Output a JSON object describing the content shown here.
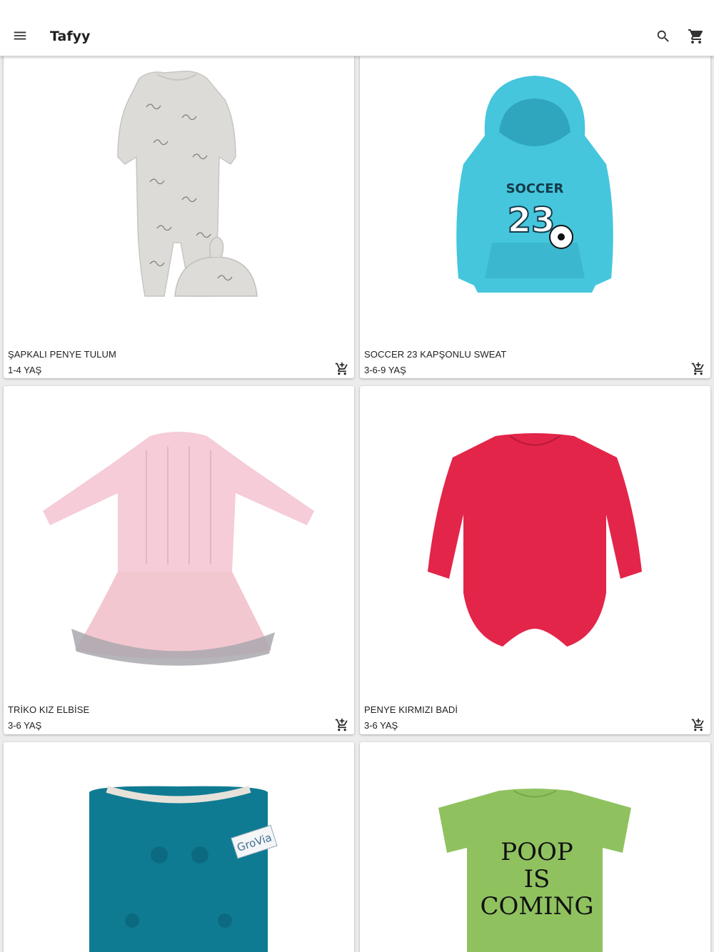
{
  "app": {
    "title": "Tafyy"
  },
  "header": {
    "menu_icon": "menu-icon",
    "search_icon": "search-icon",
    "cart_icon": "shopping-cart-icon"
  },
  "products": [
    {
      "name": "ŞAPKALI PENYE TULUM",
      "age": "1-4 YAŞ",
      "image": "grey-romper-with-hat",
      "color": "#d9d9d5"
    },
    {
      "name": "SOCCER 23 KAPŞONLU SWEAT",
      "age": "3-6-9 YAŞ",
      "image": "turquoise-hoodie",
      "color": "#3ec3da",
      "image_text": [
        "SOCCER",
        "23"
      ]
    },
    {
      "name": "TRİKO KIZ ELBİSE",
      "age": "3-6 YAŞ",
      "image": "pink-knit-tutu-dress",
      "color": "#f3ccd6"
    },
    {
      "name": "PENYE KIRMIZI BADİ",
      "age": "3-6 YAŞ",
      "image": "red-bodysuit",
      "color": "#e3244a"
    },
    {
      "name": "",
      "age": "",
      "image": "teal-cloth-diaper",
      "color": "#0f7a92",
      "image_text": [
        "GroVia"
      ]
    },
    {
      "name": "",
      "age": "",
      "image": "green-bodysuit",
      "color": "#8fc25f",
      "image_text": [
        "POOP",
        "IS",
        "COMING"
      ]
    }
  ],
  "add_to_cart_icon": "add-shopping-cart-icon"
}
